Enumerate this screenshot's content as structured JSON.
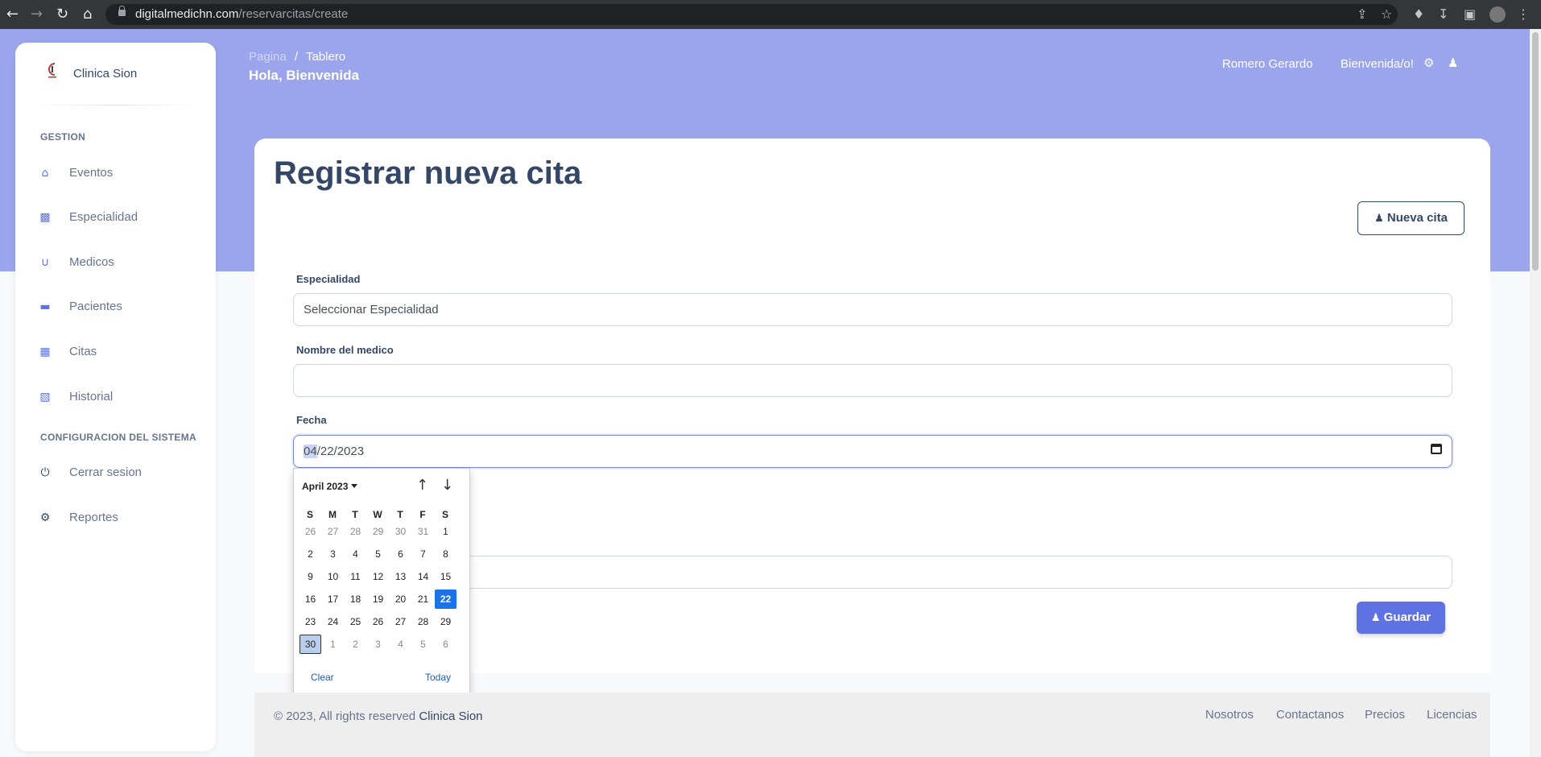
{
  "browser": {
    "url_host": "digitalmedichn.com",
    "url_path": "/reservarcitas/create",
    "back_icon": "arrow-left-icon",
    "forward_icon": "arrow-right-icon",
    "reload_icon": "reload-icon",
    "home_icon": "home-icon"
  },
  "sidebar": {
    "brand": "Clinica Sion",
    "section_gestion": "GESTION",
    "section_config": "CONFIGURACION DEL SISTEMA",
    "items": [
      {
        "label": "Eventos",
        "icon": "home-icon"
      },
      {
        "label": "Especialidad",
        "icon": "briefcase-icon"
      },
      {
        "label": "Medicos",
        "icon": "stethoscope-icon"
      },
      {
        "label": "Pacientes",
        "icon": "bed-icon"
      },
      {
        "label": "Citas",
        "icon": "calendar-icon"
      },
      {
        "label": "Historial",
        "icon": "id-badge-icon"
      }
    ],
    "config_items": [
      {
        "label": "Cerrar sesion",
        "icon": "power-icon"
      },
      {
        "label": "Reportes",
        "icon": "user-cog-icon"
      }
    ]
  },
  "header": {
    "breadcrumb_root": "Pagina",
    "breadcrumb_sep": "/",
    "breadcrumb_current": "Tablero",
    "greeting": "Hola, Bienvenida",
    "user_name": "Romero Gerardo",
    "welcome": "Bienvenida/o!"
  },
  "main": {
    "title": "Registrar nueva cita",
    "new_button": "Nueva cita",
    "fields": {
      "especialidad_label": "Especialidad",
      "especialidad_value": "Seleccionar Especialidad",
      "medico_label": "Nombre del medico",
      "medico_value": "",
      "fecha_label": "Fecha",
      "fecha_month": "04",
      "fecha_rest": "/22/2023"
    },
    "save_button": "Guardar"
  },
  "datepicker": {
    "month_label": "April 2023",
    "weekdays": [
      "S",
      "M",
      "T",
      "W",
      "T",
      "F",
      "S"
    ],
    "weeks": [
      [
        "26",
        "27",
        "28",
        "29",
        "30",
        "31",
        "1"
      ],
      [
        "2",
        "3",
        "4",
        "5",
        "6",
        "7",
        "8"
      ],
      [
        "9",
        "10",
        "11",
        "12",
        "13",
        "14",
        "15"
      ],
      [
        "16",
        "17",
        "18",
        "19",
        "20",
        "21",
        "22"
      ],
      [
        "23",
        "24",
        "25",
        "26",
        "27",
        "28",
        "29"
      ],
      [
        "30",
        "1",
        "2",
        "3",
        "4",
        "5",
        "6"
      ]
    ],
    "selected": "22",
    "today": "30",
    "clear_label": "Clear",
    "today_label": "Today"
  },
  "footer": {
    "copyright": "© 2023, All rights reserved",
    "brand": "Clinica Sion",
    "links": [
      "Nosotros",
      "Contactanos",
      "Precios",
      "Licencias"
    ]
  }
}
